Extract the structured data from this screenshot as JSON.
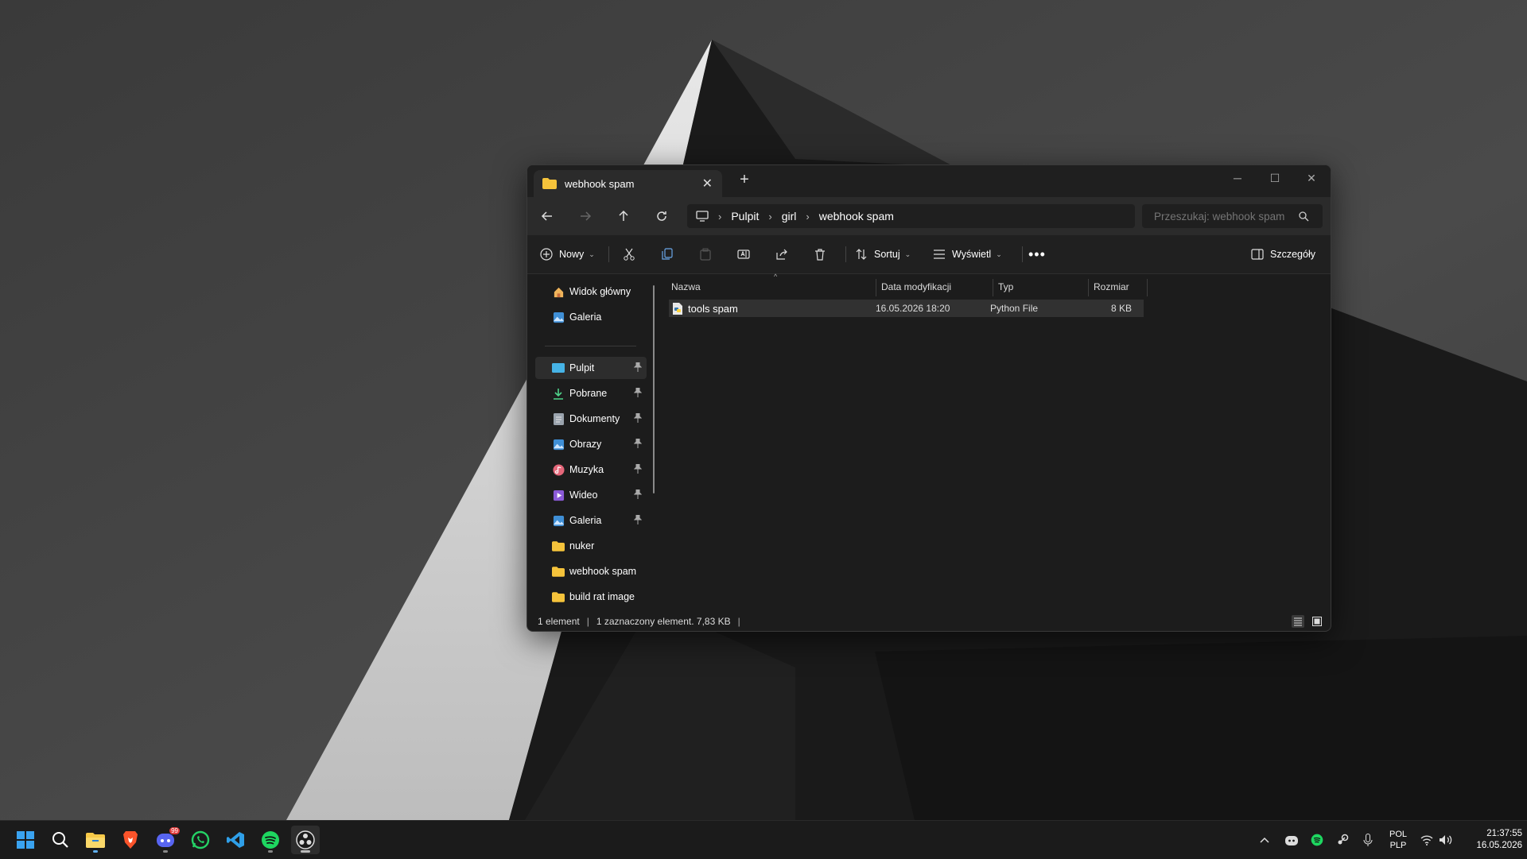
{
  "window": {
    "tab_title": "webhook spam",
    "breadcrumb": [
      "Pulpit",
      "girl",
      "webhook spam"
    ],
    "search_placeholder": "Przeszukaj: webhook spam"
  },
  "toolbar": {
    "new_label": "Nowy",
    "sort_label": "Sortuj",
    "view_label": "Wyświetl",
    "details_label": "Szczegóły"
  },
  "sidebar": {
    "top": [
      {
        "label": "Widok główny",
        "icon": "home-icon"
      },
      {
        "label": "Galeria",
        "icon": "gallery-icon"
      }
    ],
    "quick": [
      {
        "label": "Pulpit",
        "icon": "desktop-icon"
      },
      {
        "label": "Pobrane",
        "icon": "download-icon"
      },
      {
        "label": "Dokumenty",
        "icon": "document-icon"
      },
      {
        "label": "Obrazy",
        "icon": "pictures-icon"
      },
      {
        "label": "Muzyka",
        "icon": "music-icon"
      },
      {
        "label": "Wideo",
        "icon": "video-icon"
      },
      {
        "label": "Galeria",
        "icon": "gallery-icon"
      },
      {
        "label": "nuker",
        "icon": "folder-icon"
      },
      {
        "label": "webhook spam",
        "icon": "folder-icon"
      },
      {
        "label": "build rat image",
        "icon": "folder-icon"
      }
    ]
  },
  "columns": [
    "Nazwa",
    "Data modyfikacji",
    "Typ",
    "Rozmiar"
  ],
  "files": [
    {
      "name": "tools spam",
      "modified": "16.05.2026 18:20",
      "type": "Python File",
      "size": "8 KB"
    }
  ],
  "status": {
    "count": "1 element",
    "selection": "1 zaznaczony element. 7,83 KB"
  },
  "taskbar": {
    "apps": [
      "start-icon",
      "search-icon",
      "file-explorer-icon",
      "brave-icon",
      "discord-icon",
      "whatsapp-icon",
      "vscode-icon",
      "spotify-icon",
      "obs-icon"
    ],
    "discord_badge": "99",
    "lang_top": "POL",
    "lang_bottom": "PLP",
    "time": "21:37:55",
    "date": "16.05.2026"
  },
  "colors": {
    "window_bg": "#1c1c1c",
    "accent_folder": "#f5c33b",
    "selected_row": "#313131",
    "taskbar_bg": "#1b1b1b"
  }
}
